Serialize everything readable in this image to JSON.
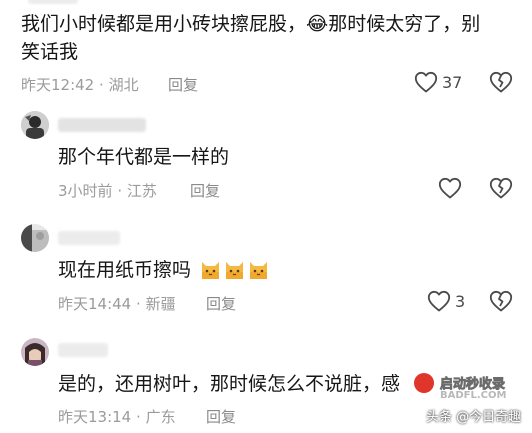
{
  "comments": [
    {
      "level": "top",
      "text_line1": "我们小时候都是用小砖块擦屁股，",
      "emoji": "😂",
      "text_line1_tail": "那时候太穷了，别",
      "text_line2": "笑话我",
      "time": "昨天12:42",
      "sep": "·",
      "location": "湖北",
      "reply_label": "回复",
      "like_count": "37"
    },
    {
      "level": "reply",
      "text": "那个年代都是一样的",
      "time": "3小时前",
      "sep": "·",
      "location": "江苏",
      "reply_label": "回复",
      "like_count": ""
    },
    {
      "level": "reply",
      "text": "现在用纸币擦吗",
      "time": "昨天14:44",
      "sep": "·",
      "location": "新疆",
      "reply_label": "回复",
      "like_count": "3"
    },
    {
      "level": "reply",
      "text": "是的，还用树叶，那时候怎么不说脏，感",
      "time": "昨天13:14",
      "sep": "·",
      "location": "广东",
      "reply_label": "回复",
      "like_count": ""
    }
  ],
  "icons": {
    "like": "heart-outline-icon",
    "dislike": "broken-heart-icon",
    "emoji_cat": "cat-face-emoji"
  },
  "watermarks": {
    "site_top": "启动秒收录",
    "site_bottom": "BADFL.COM",
    "author": "头条 @今日奇趣"
  },
  "colors": {
    "text": "#161616",
    "meta": "#9b9b9b",
    "icon": "#4a4a4a",
    "cat": "#f5b942",
    "watermark_red": "#e0352b"
  }
}
